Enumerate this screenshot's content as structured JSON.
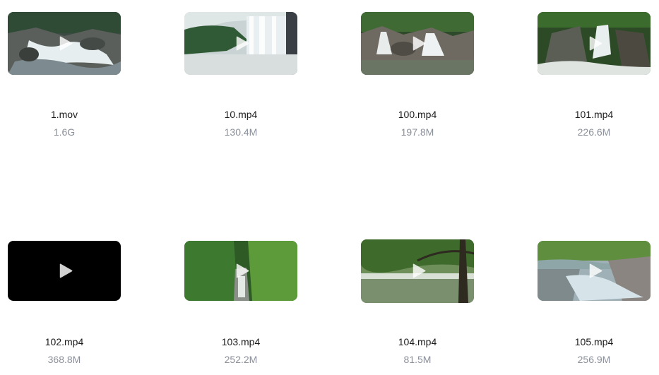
{
  "files": [
    {
      "name": "1.mov",
      "size": "1.6G",
      "thumb": "rapids-icon"
    },
    {
      "name": "10.mp4",
      "size": "130.4M",
      "thumb": "waterfall-icon"
    },
    {
      "name": "100.mp4",
      "size": "197.8M",
      "thumb": "rock-cascade-icon"
    },
    {
      "name": "101.mp4",
      "size": "226.6M",
      "thumb": "forest-waterfall-icon"
    },
    {
      "name": "102.mp4",
      "size": "368.8M",
      "thumb": "black-frame-icon"
    },
    {
      "name": "103.mp4",
      "size": "252.2M",
      "thumb": "green-gorge-icon"
    },
    {
      "name": "104.mp4",
      "size": "81.5M",
      "thumb": "river-tree-icon"
    },
    {
      "name": "105.mp4",
      "size": "256.9M",
      "thumb": "rocky-stream-icon"
    }
  ],
  "colors": {
    "name_text": "#1b1b1b",
    "size_text": "#8a8f99",
    "play_icon": "#ffffff"
  }
}
